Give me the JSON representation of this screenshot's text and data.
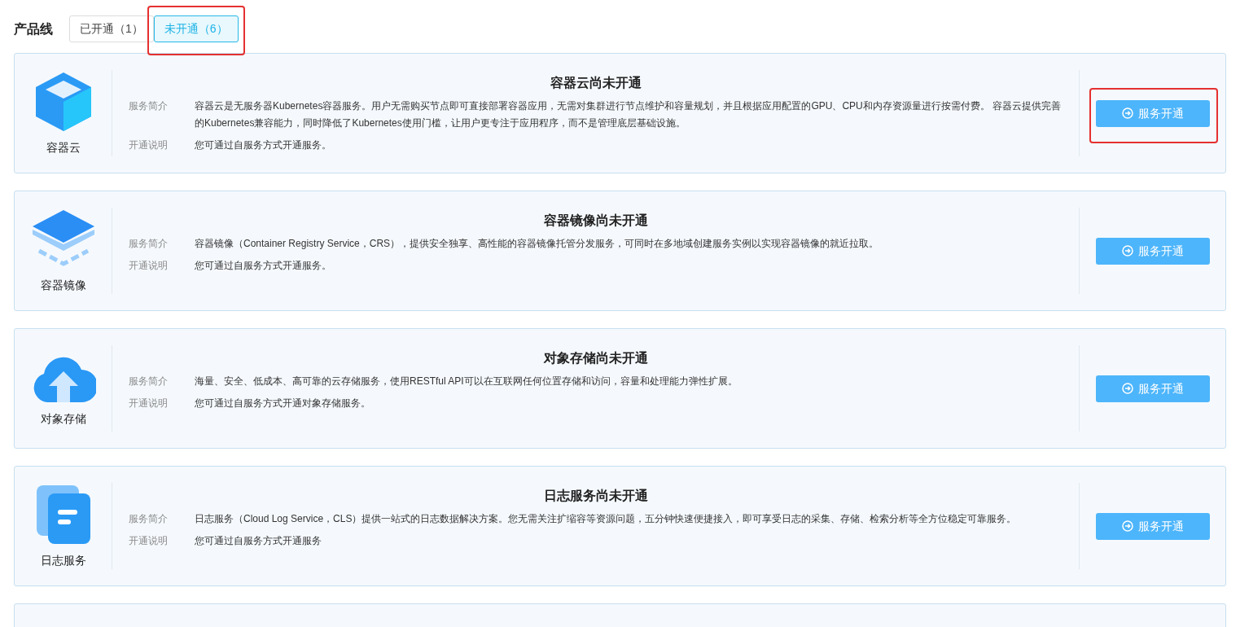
{
  "header": {
    "title": "产品线",
    "tabs": [
      {
        "label": "已开通（1）",
        "selected": false,
        "highlighted": false
      },
      {
        "label": "未开通（6）",
        "selected": true,
        "highlighted": true
      }
    ]
  },
  "products": [
    {
      "name": "容器云",
      "title": "容器云尚未开通",
      "intro_label": "服务简介",
      "intro": "容器云是无服务器Kubernetes容器服务。用户无需购买节点即可直接部署容器应用，无需对集群进行节点维护和容量规划，并且根据应用配置的GPU、CPU和内存资源量进行按需付费。 容器云提供完善的Kubernetes兼容能力，同时降低了Kubernetes使用门槛，让用户更专注于应用程序，而不是管理底层基础设施。",
      "note_label": "开通说明",
      "note": "您可通过自服务方式开通服务。",
      "button": "服务开通",
      "highlighted": true
    },
    {
      "name": "容器镜像",
      "title": "容器镜像尚未开通",
      "intro_label": "服务简介",
      "intro": "容器镜像（Container Registry Service，CRS），提供安全独享、高性能的容器镜像托管分发服务，可同时在多地域创建服务实例以实现容器镜像的就近拉取。",
      "note_label": "开通说明",
      "note": "您可通过自服务方式开通服务。",
      "button": "服务开通",
      "highlighted": false
    },
    {
      "name": "对象存储",
      "title": "对象存储尚未开通",
      "intro_label": "服务简介",
      "intro": "海量、安全、低成本、高可靠的云存储服务，使用RESTful API可以在互联网任何位置存储和访问，容量和处理能力弹性扩展。",
      "note_label": "开通说明",
      "note": "您可通过自服务方式开通对象存储服务。",
      "button": "服务开通",
      "highlighted": false
    },
    {
      "name": "日志服务",
      "title": "日志服务尚未开通",
      "intro_label": "服务简介",
      "intro": "日志服务（Cloud Log Service，CLS）提供一站式的日志数据解决方案。您无需关注扩缩容等资源问题，五分钟快速便捷接入，即可享受日志的采集、存储、检索分析等全方位稳定可靠服务。",
      "note_label": "开通说明",
      "note": "您可通过自服务方式开通服务",
      "button": "服务开通",
      "highlighted": false
    }
  ]
}
